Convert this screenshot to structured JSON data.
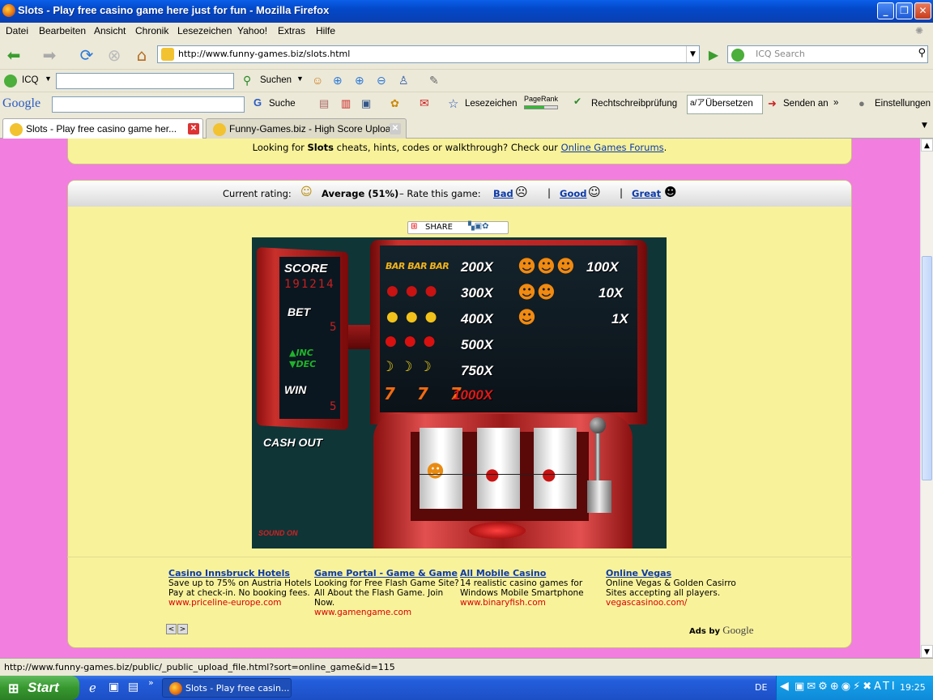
{
  "window": {
    "title": "Slots - Play free casino game here just for fun - Mozilla Firefox"
  },
  "menu": [
    "Datei",
    "Bearbeiten",
    "Ansicht",
    "Chronik",
    "Lesezeichen",
    "Yahoo!",
    "Extras",
    "Hilfe"
  ],
  "nav": {
    "url": "http://www.funny-games.biz/slots.html",
    "search_placeholder": "ICQ Search"
  },
  "icq_toolbar": {
    "label": "ICQ",
    "search_label": "Suchen"
  },
  "google_toolbar": {
    "logo": "Google",
    "suche": "Suche",
    "lesezeichen": "Lesezeichen",
    "pagerank": "PageRank",
    "spell": "Rechtschreibprüfung",
    "translate": "Übersetzen",
    "send": "Senden an",
    "more": "»",
    "settings": "Einstellungen"
  },
  "tabs": [
    {
      "label": "Slots - Play free casino game her..."
    },
    {
      "label": "Funny-Games.biz - High Score Upload"
    }
  ],
  "page": {
    "cheats_prefix": "Looking for ",
    "cheats_game": "Slots",
    "cheats_middle": " cheats, hints, codes or walkthrough? Check our ",
    "cheats_link": "Online Games Forums",
    "cheats_end": ".",
    "rating_label": "Current rating:",
    "rating_value": "Average (51%)",
    "rate_label": "–  Rate this game:",
    "bad": "Bad",
    "good": "Good",
    "great": "Great",
    "share": "SHARE"
  },
  "game": {
    "score_label": "SCORE",
    "score_value": "191214",
    "bet_label": "BET",
    "bet_value": "5",
    "inc": "INC",
    "dec": "DEC",
    "win_label": "WIN",
    "win_value": "5",
    "cash_out": "CASH OUT",
    "sound": "SOUND ON",
    "paytable_left": [
      {
        "symbol": "BAR BAR BAR",
        "payout": "200X"
      },
      {
        "symbol": "cherries",
        "payout": "300X"
      },
      {
        "symbol": "pears",
        "payout": "400X"
      },
      {
        "symbol": "apples",
        "payout": "500X"
      },
      {
        "symbol": "bananas",
        "payout": "750X"
      },
      {
        "symbol": "7 7 7",
        "payout": "1000X"
      }
    ],
    "paytable_right": [
      {
        "symbol": "3 smileys",
        "payout": "100X"
      },
      {
        "symbol": "2 smileys",
        "payout": "10X"
      },
      {
        "symbol": "1 smiley",
        "payout": "1X"
      }
    ]
  },
  "ads": [
    {
      "title": "Casino Innsbruck Hotels",
      "text": "Save up to 75% on Austria Hotels Pay at check-in. No booking fees.",
      "url": "www.priceline-europe.com"
    },
    {
      "title": "Game Portal - Game & Game",
      "text": "Looking for Free Flash Game Site? All About the Flash Game. Join Now.",
      "url": "www.gamengame.com"
    },
    {
      "title": "All Mobile Casino",
      "text": "14 realistic casino games for Windows Mobile Smartphone",
      "url": "www.binaryfish.com"
    },
    {
      "title": "Online Vegas",
      "text": "Online Vegas & Golden Casirro Sites accepting all players.",
      "url": "vegascasinoo.com/"
    }
  ],
  "ads_by": "Ads by",
  "ads_google": "Google",
  "status": "http://www.funny-games.biz/public/_public_upload_file.html?sort=online_game&id=115",
  "taskbar": {
    "start": "Start",
    "task": "Slots - Play free casin...",
    "lang": "DE",
    "clock": "19:25"
  },
  "colors": {
    "page_bg": "#f27ee0",
    "panel_bg": "#f8f29b",
    "link": "#0d3aa8",
    "game_bg": "#0f3537"
  }
}
